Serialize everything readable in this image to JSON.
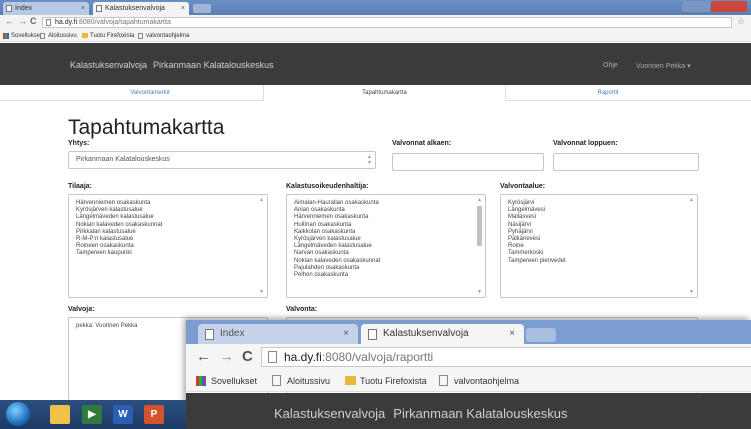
{
  "back_browser": {
    "tabs": [
      {
        "label": "Index",
        "active": false
      },
      {
        "label": "Kalastuksenvalvoja",
        "active": true
      }
    ],
    "url_host": "ha.dy.fi",
    "url_path": ":8080/valvoja/tapahtumakartta",
    "bookmarks": [
      "Sovellukset",
      "Aloitussivu",
      "Tuotu Firefoxista",
      "valvontaohjelma"
    ]
  },
  "navbar": {
    "brand_primary": "Kalastuksenvalvoja",
    "brand_secondary": "Pirkanmaan Kalatalouskeskus",
    "right_link": "Ohje",
    "user_menu": "Vuorinen Pekka ▾"
  },
  "subnav": [
    "Valvontamerkit",
    "Tapahtumakartta",
    "Raportit"
  ],
  "page": {
    "title": "Tapahtumakartta",
    "yhtys_label": "Yhtys:",
    "yhtys_value": "Pirkanmaan Kalatalouskeskus",
    "start_label": "Valvonnat alkaen:",
    "end_label": "Valvonnat loppuen:",
    "tilaaja_label": "Tilaaja:",
    "tilaaja_items": [
      "Härvenniemen osakaskunta",
      "Kyrösjärven kalastusalue",
      "Längelmäveden kalastusalue",
      "Nokian kalaveden osakaskunnat",
      "Pirkkalan kalastusalue",
      "R-M-P:n kalastusalue",
      "Roineen osakaskunta",
      "Tampereen kaupunki"
    ],
    "haltija_label": "Kalastusoikeudenhaltija:",
    "haltija_items": [
      "Aimalan-Haurallan osakaskunta",
      "Anian osakaskunta",
      "Härvenniemen osakaskunta",
      "Huitinan osakaskunta",
      "Kaikkolan osakaskunta",
      "Kyrösjärven kalastusalue",
      "Längelmäveden kalastusalue",
      "Narvan osakaskunta",
      "Nokian kalaveden osakaskunnat",
      "Pajulahden osakaskunta",
      "Pelhon osakaskunta"
    ],
    "valvontaalue_label": "Valvontaalue:",
    "valvontaalue_items": [
      "Kyrösjärvi",
      "Längelmävesi",
      "Mallasvesi",
      "Näsijärvi",
      "Pyhäjärvi",
      "Pälkänevesi",
      "Roine",
      "Tammerkoski",
      "Tampereen pienvedet"
    ],
    "valvoja_label": "Valvoja:",
    "valvoja_items": [
      "pekka: Vuorinen Pekka"
    ],
    "valvonta_label": "Valvonta:"
  },
  "front_browser": {
    "tabs": [
      {
        "label": "Index",
        "active": false
      },
      {
        "label": "Kalastuksenvalvoja",
        "active": true
      }
    ],
    "url_host": "ha.dy.fi",
    "url_path": ":8080/valvoja/raportti",
    "bookmarks": [
      "Sovellukset",
      "Aloitussivu",
      "Tuotu Firefoxista",
      "valvontaohjelma"
    ],
    "brand_primary": "Kalastuksenvalvoja",
    "brand_secondary": "Pirkanmaan Kalatalouskeskus"
  },
  "taskbar": {
    "apps": [
      "explorer-icon",
      "media-player-icon",
      "word-icon",
      "powerpoint-icon"
    ],
    "word_letter": "W",
    "powerpoint_letter": "P"
  },
  "colors": {
    "navbar_bg": "#3b3b3b",
    "link": "#4f78b8",
    "tabstrip": "#6a8fc4"
  }
}
